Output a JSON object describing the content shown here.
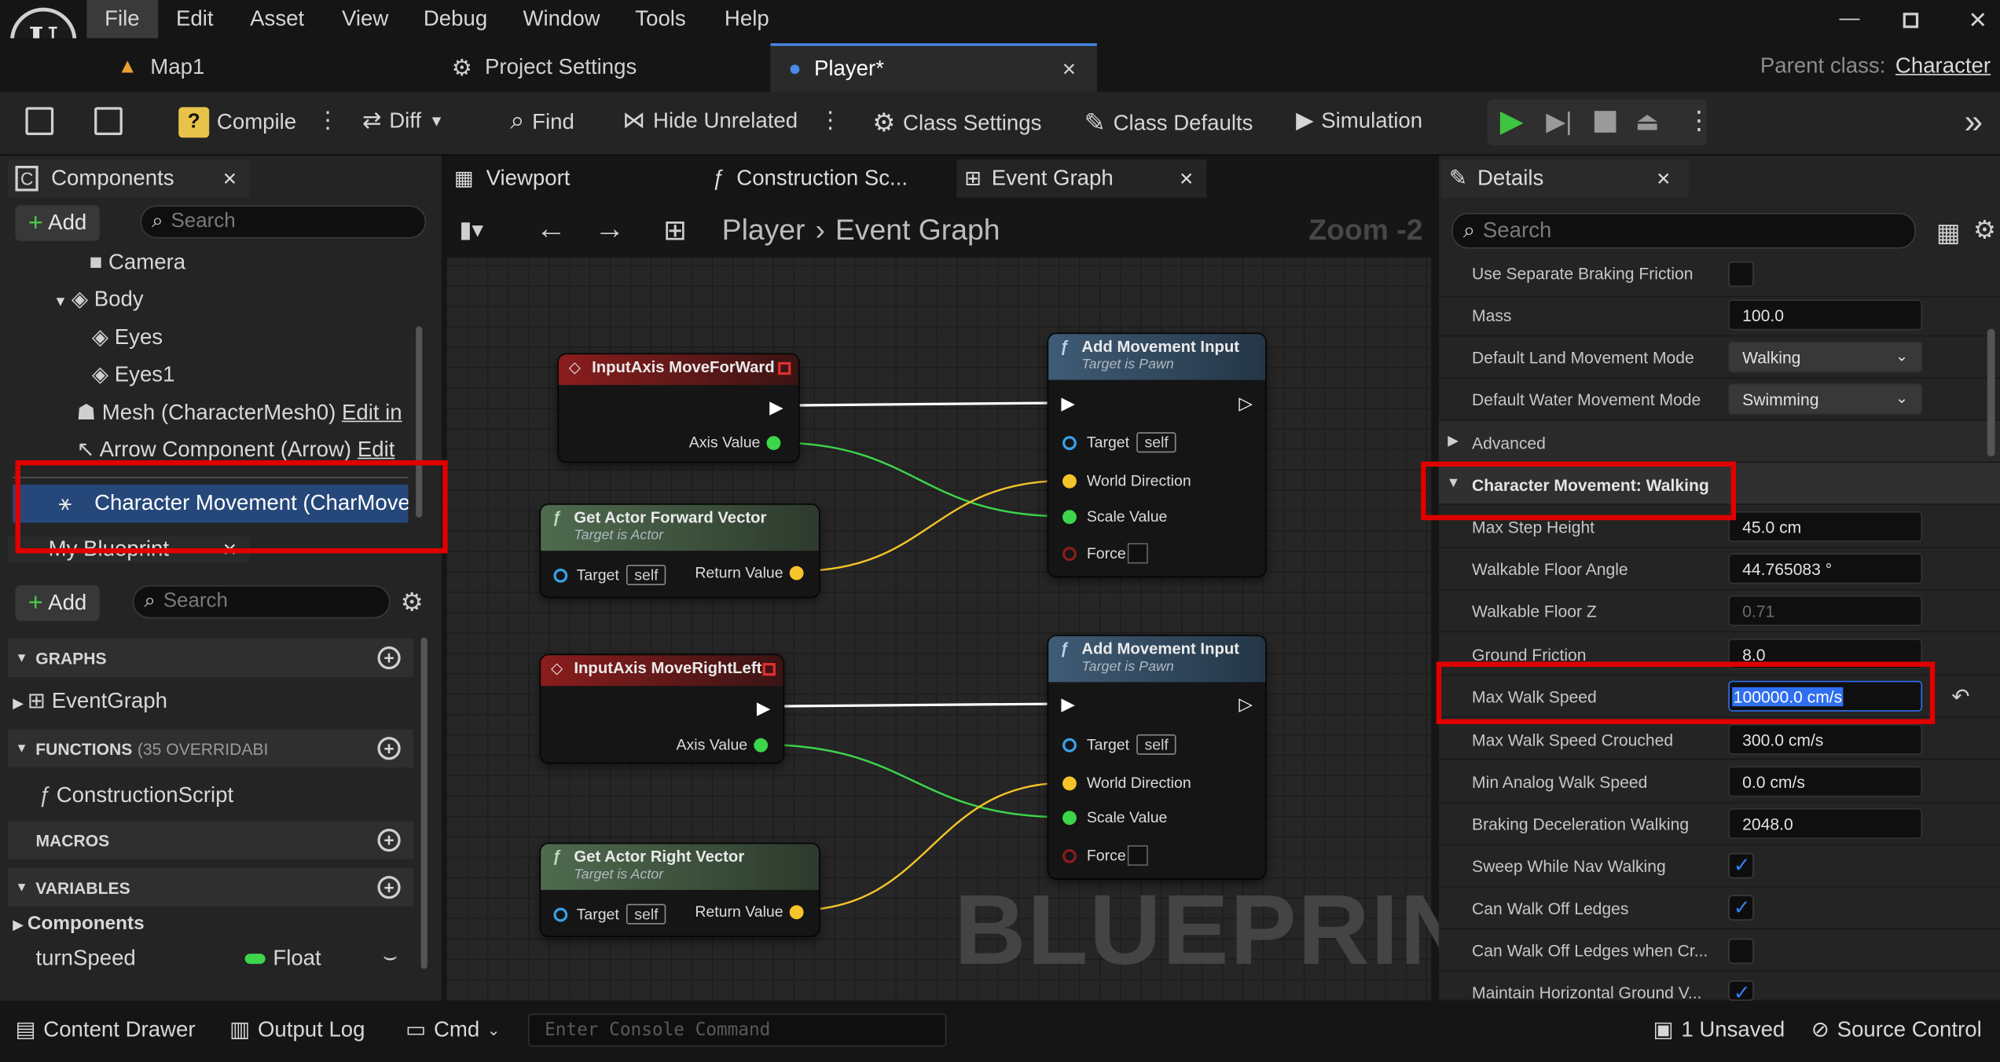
{
  "menu": [
    "File",
    "Edit",
    "Asset",
    "View",
    "Debug",
    "Window",
    "Tools",
    "Help"
  ],
  "tabs": {
    "map": "Map1",
    "project_settings": "Project Settings",
    "player": "Player*"
  },
  "parent_class": {
    "label": "Parent class:",
    "value": "Character"
  },
  "toolbar": {
    "compile": "Compile",
    "diff": "Diff",
    "find": "Find",
    "hide_unrelated": "Hide Unrelated",
    "class_settings": "Class Settings",
    "class_defaults": "Class Defaults",
    "simulation": "Simulation"
  },
  "components": {
    "tab": "Components",
    "add": "Add",
    "search_placeholder": "Search",
    "items": {
      "camera": "Camera",
      "body": "Body",
      "eyes": "Eyes",
      "eyes1": "Eyes1",
      "mesh": "Mesh (CharacterMesh0)",
      "mesh_edit": "Edit in",
      "arrow": "Arrow Component (Arrow)",
      "arrow_edit": "Edit",
      "char_move": "Character Movement (CharMoveComp)"
    }
  },
  "my_blueprint": {
    "tab": "My Blueprint",
    "add": "Add",
    "search_placeholder": "Search",
    "graphs": "GRAPHS",
    "event_graph": "EventGraph",
    "functions": "FUNCTIONS",
    "functions_count": "(35 OVERRIDABI",
    "construction_script": "ConstructionScript",
    "macros": "MACROS",
    "variables": "VARIABLES",
    "components_cat": "Components",
    "var_name": "turnSpeed",
    "var_type": "Float"
  },
  "editor_tabs": {
    "viewport": "Viewport",
    "construction": "Construction Sc...",
    "event_graph": "Event Graph"
  },
  "graph": {
    "breadcrumb_root": "Player",
    "breadcrumb_leaf": "Event Graph",
    "zoom": "Zoom -2",
    "watermark": "BLUEPRINT",
    "nodes": {
      "input_fwd": {
        "title": "InputAxis MoveForWard",
        "axis": "Axis Value"
      },
      "fwd_vec": {
        "title": "Get Actor Forward Vector",
        "subtitle": "Target is Actor",
        "target": "Target",
        "self": "self",
        "ret": "Return Value"
      },
      "add_move1": {
        "title": "Add Movement Input",
        "subtitle": "Target is Pawn",
        "target": "Target",
        "self": "self",
        "world_dir": "World Direction",
        "scale": "Scale Value",
        "force": "Force"
      },
      "input_right": {
        "title": "InputAxis MoveRightLeft",
        "axis": "Axis Value"
      },
      "right_vec": {
        "title": "Get Actor Right Vector",
        "subtitle": "Target is Actor",
        "target": "Target",
        "self": "self",
        "ret": "Return Value"
      },
      "add_move2": {
        "title": "Add Movement Input",
        "subtitle": "Target is Pawn",
        "target": "Target",
        "self": "self",
        "world_dir": "World Direction",
        "scale": "Scale Value",
        "force": "Force"
      }
    }
  },
  "details": {
    "tab": "Details",
    "search_placeholder": "Search",
    "rows": {
      "sep_braking": "Use Separate Braking Friction",
      "mass": "Mass",
      "mass_val": "100.0",
      "land_mode": "Default Land Movement Mode",
      "land_mode_val": "Walking",
      "water_mode": "Default Water Movement Mode",
      "water_mode_val": "Swimming",
      "advanced": "Advanced",
      "section": "Character Movement: Walking",
      "step": "Max Step Height",
      "step_val": "45.0 cm",
      "floor_angle": "Walkable Floor Angle",
      "floor_angle_val": "44.765083 °",
      "floor_z": "Walkable Floor Z",
      "floor_z_val": "0.71",
      "ground_fric": "Ground Friction",
      "ground_fric_val": "8.0",
      "max_walk": "Max Walk Speed",
      "max_walk_val": "100000.0 cm/s",
      "max_crouch": "Max Walk Speed Crouched",
      "max_crouch_val": "300.0 cm/s",
      "min_analog": "Min Analog Walk Speed",
      "min_analog_val": "0.0 cm/s",
      "brake_decel": "Braking Deceleration Walking",
      "brake_decel_val": "2048.0",
      "sweep": "Sweep While Nav Walking",
      "walk_off": "Can Walk Off Ledges",
      "walk_off_cr": "Can Walk Off Ledges when Cr...",
      "maintain": "Maintain Horizontal Ground V..."
    }
  },
  "status": {
    "content_drawer": "Content Drawer",
    "output_log": "Output Log",
    "cmd": "Cmd",
    "console_placeholder": "Enter Console Command",
    "unsaved": "1 Unsaved",
    "source_control": "Source Control"
  },
  "colors": {
    "highlight": "#e00000",
    "exec": "#ffffff",
    "float_pin": "#3dd54a",
    "vector_pin": "#f5c32a",
    "object_pin": "#3aa0e8",
    "input_header": "#8b1d1d",
    "pure_header": "#4f6b4f",
    "call_header": "#3f5c76",
    "selection": "#2f6ff0"
  }
}
